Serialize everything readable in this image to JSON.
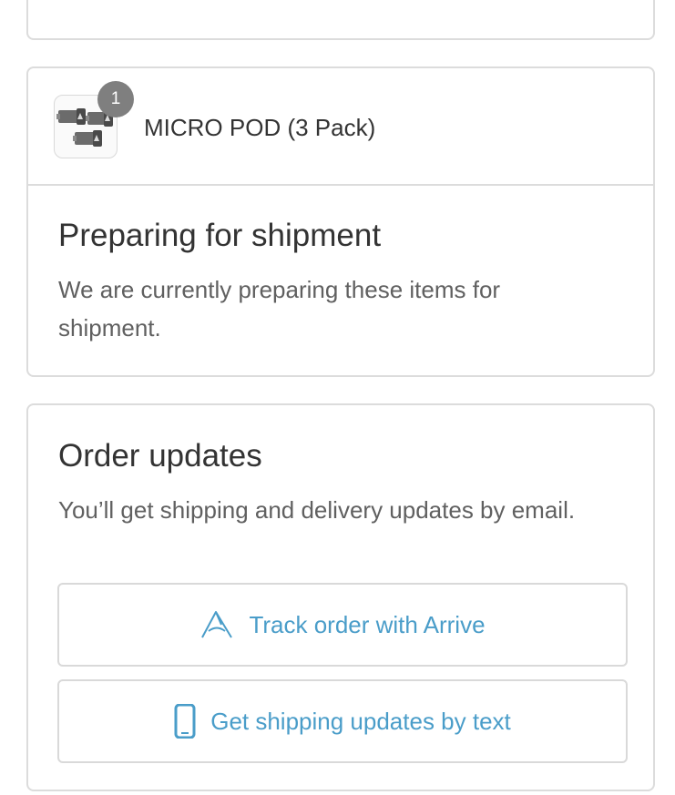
{
  "product": {
    "name": "MICRO POD (3 Pack)",
    "quantity": "1",
    "thumbnail_icon": "product-thumbnail-image"
  },
  "shipment": {
    "title": "Preparing for shipment",
    "description": "We are currently preparing these items for shipment."
  },
  "order_updates": {
    "title": "Order updates",
    "description": "You’ll get shipping and delivery updates by email.",
    "track_button": {
      "label": "Track order with Arrive",
      "icon": "arrive-logo-icon"
    },
    "text_button": {
      "label": "Get shipping updates by text",
      "icon": "phone-icon"
    }
  },
  "colors": {
    "accent": "#4a9dc9",
    "border": "#dcdcdc",
    "badge": "#7f7f7f"
  }
}
